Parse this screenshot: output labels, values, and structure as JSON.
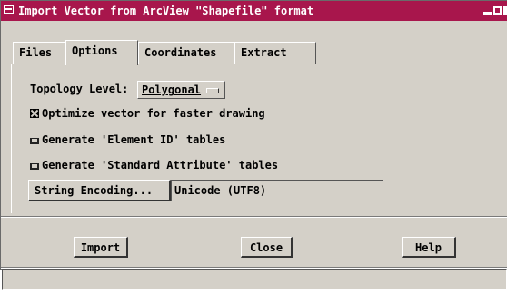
{
  "window": {
    "title": "Import Vector from ArcView \"Shapefile\" format",
    "accent_color": "#a8164c",
    "titlebar_buttons": [
      "minimize-icon",
      "maximize-icon",
      "close-icon"
    ]
  },
  "tabs": [
    {
      "label": "Files",
      "active": false
    },
    {
      "label": "Options",
      "active": true
    },
    {
      "label": "Coordinates",
      "active": false
    },
    {
      "label": "Extract",
      "active": false
    }
  ],
  "options": {
    "topology_label": "Topology Level:",
    "topology_value": "Polygonal",
    "checkboxes": [
      {
        "label": "Optimize vector for faster drawing",
        "checked": true
      },
      {
        "label": "Generate 'Element ID' tables",
        "checked": false
      },
      {
        "label": "Generate 'Standard Attribute' tables",
        "checked": false
      }
    ],
    "string_encoding_button": "String Encoding...",
    "string_encoding_value": "Unicode (UTF8)"
  },
  "buttons": {
    "import": "Import",
    "close": "Close",
    "help": "Help"
  },
  "status": ""
}
